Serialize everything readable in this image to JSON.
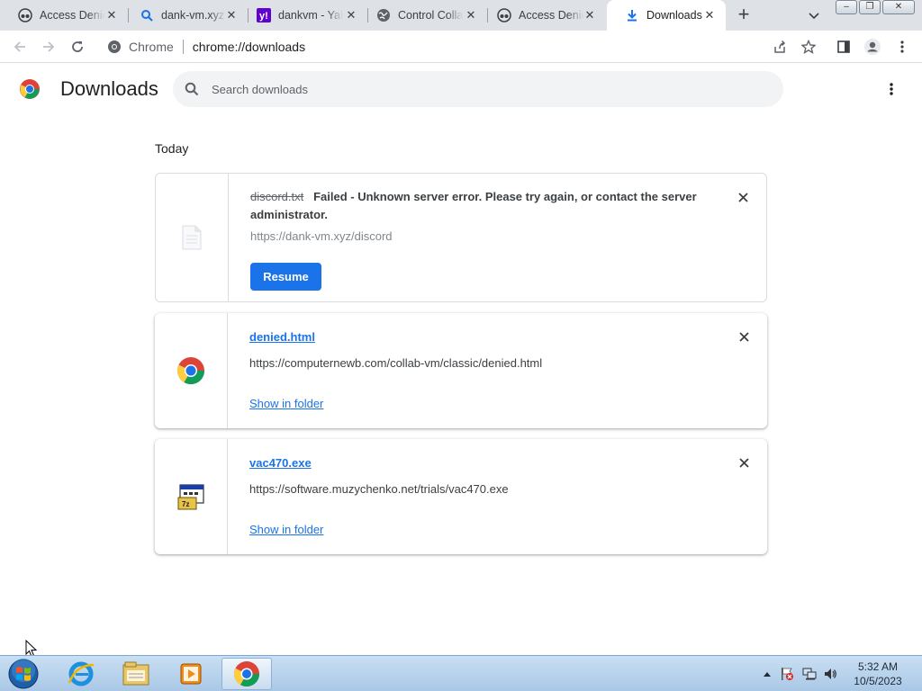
{
  "tabs": [
    {
      "title": "Access Denied",
      "icon": "incognito-like-icon",
      "active": false
    },
    {
      "title": "dank-vm.xyz",
      "icon": "search-icon",
      "active": false
    },
    {
      "title": "dankvm - Yahoo",
      "icon": "yahoo-icon",
      "active": false
    },
    {
      "title": "Control Collab",
      "icon": "globe-icon",
      "active": false
    },
    {
      "title": "Access Denied",
      "icon": "incognito-like-icon",
      "active": false
    },
    {
      "title": "Downloads",
      "icon": "download-icon",
      "active": true
    }
  ],
  "window_controls": {
    "minimize": "–",
    "restore": "❐",
    "close": "✕"
  },
  "omnibox": {
    "chip": "Chrome",
    "url": "chrome://downloads"
  },
  "downloads_page": {
    "title": "Downloads",
    "search_placeholder": "Search downloads",
    "section_label": "Today",
    "items": [
      {
        "file_name": "discord.txt",
        "status": "Failed - Unknown server error. Please try again, or contact the server administrator.",
        "url": "https://dank-vm.xyz/discord",
        "action": "Resume",
        "state": "failed"
      },
      {
        "file_name": "denied.html",
        "url": "https://computernewb.com/collab-vm/classic/denied.html",
        "action": "Show in folder",
        "state": "complete"
      },
      {
        "file_name": "vac470.exe",
        "url": "https://software.muzychenko.net/trials/vac470.exe",
        "action": "Show in folder",
        "state": "complete"
      }
    ]
  },
  "taskbar": {
    "clock_time": "5:32 AM",
    "clock_date": "10/5/2023",
    "pinned": [
      "internet-explorer-icon",
      "file-explorer-icon",
      "media-player-icon",
      "chrome-icon"
    ]
  },
  "colors": {
    "accent": "#1a73e8",
    "tabstrip": "#dee1e6",
    "taskbar": "#b9d3ec"
  }
}
